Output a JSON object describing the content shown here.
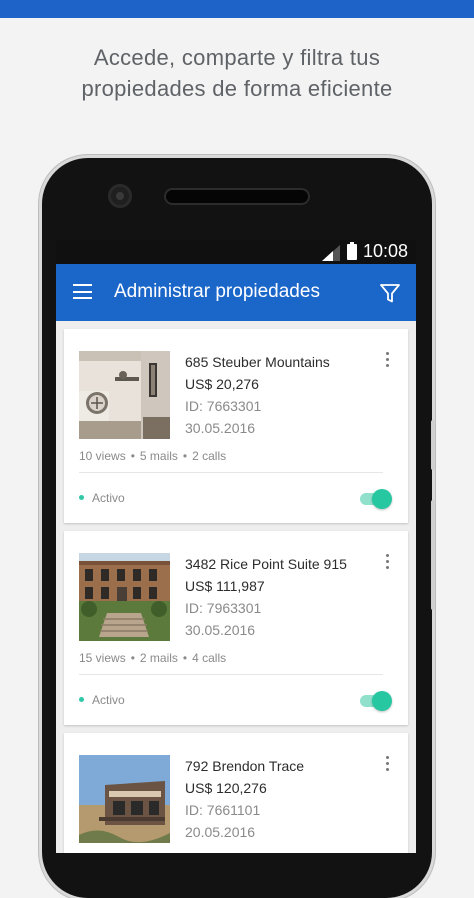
{
  "headline": {
    "line1": "Accede, comparte y filtra tus",
    "line2": "propiedades de forma eficiente"
  },
  "status_bar": {
    "time": "10:08",
    "icons": [
      "signal-icon",
      "battery-icon"
    ]
  },
  "app_bar": {
    "title": "Administrar propiedades",
    "left_icon": "menu-icon",
    "right_icon": "filter-icon"
  },
  "properties": [
    {
      "address": "685 Steuber Mountains",
      "price": "US$ 20,276",
      "id": "ID: 7663301",
      "date": "30.05.2016",
      "views": "10 views",
      "mails": "5 mails",
      "calls": "2 calls",
      "status": "Activo",
      "active": true,
      "image": "interior-room-photo"
    },
    {
      "address": "3482 Rice Point Suite 915",
      "price": "US$ 111,987",
      "id": "ID: 7963301",
      "date": "30.05.2016",
      "views": "15 views",
      "mails": "2 mails",
      "calls": "4 calls",
      "status": "Activo",
      "active": true,
      "image": "brick-mansion-photo"
    },
    {
      "address": "792 Brendon Trace",
      "price": "US$ 120,276",
      "id": "ID: 7661101",
      "date": "20.05.2016",
      "image": "modern-house-photo"
    }
  ],
  "separator": "•",
  "colors": {
    "top_bar": "#1e63c8",
    "app_bar": "#1b66c9",
    "active_accent": "#27c7a2"
  }
}
